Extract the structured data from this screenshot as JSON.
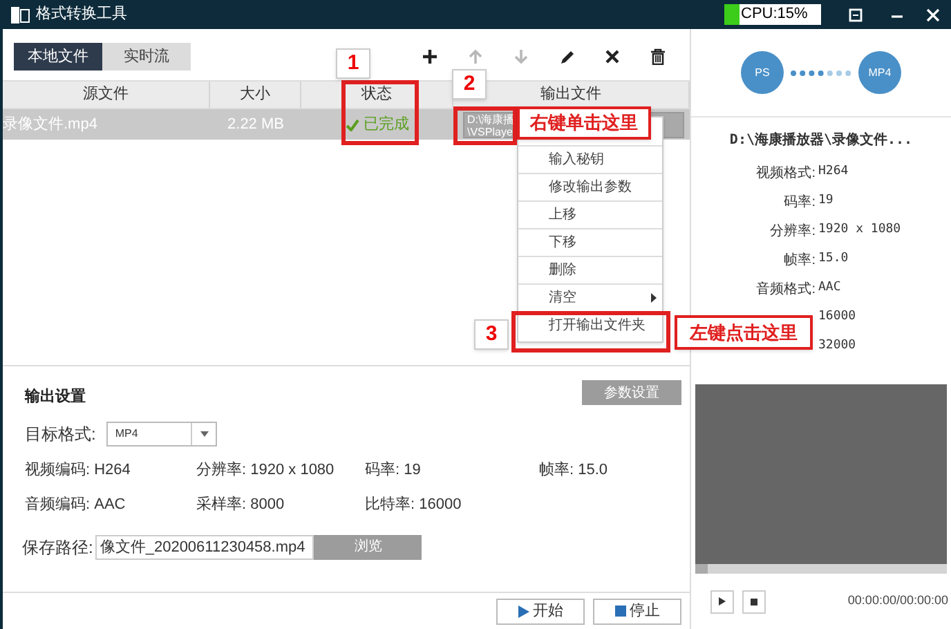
{
  "window": {
    "title": "格式转换工具",
    "cpu": {
      "label": "CPU:15%",
      "level": 0.15
    }
  },
  "tabs": [
    {
      "label": "本地文件",
      "selected": true
    },
    {
      "label": "实时流",
      "selected": false
    }
  ],
  "toolbar": [
    {
      "kind": "add",
      "disabled": false
    },
    {
      "kind": "up",
      "disabled": true
    },
    {
      "kind": "down",
      "disabled": true
    },
    {
      "kind": "edit",
      "disabled": false
    },
    {
      "kind": "remove",
      "disabled": false
    },
    {
      "kind": "trash",
      "disabled": false
    }
  ],
  "table": {
    "columns": [
      "源文件",
      "大小",
      "状态",
      "输出文件"
    ],
    "rows": [
      {
        "selected": true,
        "source": "录像文件.mp4",
        "size": "2.22 MB",
        "status": "已完成",
        "output": [
          "D:\\海康播",
          "\\VSPlaye"
        ]
      }
    ]
  },
  "context_menu": [
    {
      "label": "输入秘钥",
      "submenu": false
    },
    {
      "label": "修改输出参数",
      "submenu": false
    },
    {
      "label": "上移",
      "submenu": false
    },
    {
      "label": "下移",
      "submenu": false
    },
    {
      "label": "删除",
      "submenu": false
    },
    {
      "label": "清空",
      "submenu": true
    },
    {
      "label": "打开输出文件夹",
      "submenu": false
    }
  ],
  "annotations": {
    "markers": [
      "1",
      "2",
      "3"
    ],
    "callouts": [
      "右键单击这里",
      "左键点击这里"
    ]
  },
  "output_settings": {
    "title": "输出设置",
    "params_button": "参数设置",
    "target_format": {
      "label": "目标格式:",
      "value": "MP4"
    },
    "specs": [
      [
        "视频编码: H264",
        "分辨率: 1920 x 1080",
        "码率: 19",
        "帧率: 15.0"
      ],
      [
        "音频编码: AAC",
        "采样率: 8000",
        "比特率: 16000"
      ]
    ],
    "save_path": {
      "label": "保存路径:",
      "value": "像文件_20200611230458.mp4",
      "button": "浏览"
    }
  },
  "actions": [
    {
      "kind": "play",
      "label": "开始"
    },
    {
      "kind": "stop",
      "label": "停止"
    }
  ],
  "preview": {
    "from": "PS",
    "to": "MP4",
    "path": "D:\\海康播放器\\录像文件...",
    "info": [
      {
        "label": "视频格式:",
        "value": "H264"
      },
      {
        "label": "码率:",
        "value": "19"
      },
      {
        "label": "分辨率:",
        "value": "1920 x 1080"
      },
      {
        "label": "帧率:",
        "value": "15.0"
      },
      {
        "label": "音频格式:",
        "value": "AAC"
      },
      {
        "value": "16000"
      },
      {
        "value": "32000"
      }
    ],
    "time": "00:00:00/00:00:00"
  }
}
